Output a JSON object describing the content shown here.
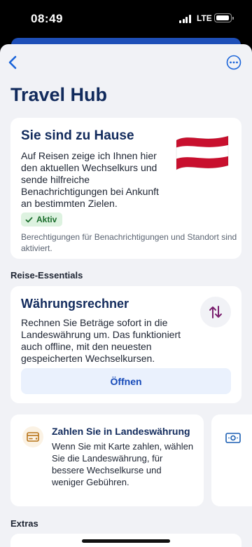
{
  "status_bar": {
    "time": "08:49",
    "network": "LTE"
  },
  "page": {
    "title": "Travel Hub"
  },
  "home_card": {
    "title": "Sie sind zu Hause",
    "body": "Auf Reisen zeige ich Ihnen hier den aktuellen Wechselkurs und sende hilfreiche Benachrichtigungen bei Ankunft an bestimmten Zielen.",
    "badge": "Aktiv",
    "note": "Berechtigungen für Benachrichtigungen und Standort sind aktiviert."
  },
  "essentials": {
    "section_title": "Reise-Essentials",
    "currency": {
      "title": "Währungsrechner",
      "body": "Rechnen Sie Beträge sofort in die Landeswährung um. Das funktioniert auch offline, mit den neuesten gespeicherten Wechselkursen.",
      "button": "Öffnen"
    },
    "pay_local": {
      "title": "Zahlen Sie in Landeswährung",
      "body": "Wenn Sie mit Karte zahlen, wählen Sie die Landeswährung, für bessere Wechselkurse und weniger Gebühren."
    }
  },
  "extras": {
    "section_title": "Extras"
  },
  "colors": {
    "accent": "#1a64d9",
    "title": "#112a5c",
    "active_badge_bg": "#ddf2e0",
    "active_badge_text": "#1b6d2c",
    "sheet_background": "#f1f2f6",
    "flag_red": "#c8102e"
  },
  "icons": [
    "chevron-left-icon",
    "more-icon",
    "austria-flag-icon",
    "check-icon",
    "exchange-arrows-icon",
    "card-icon",
    "cash-icon"
  ]
}
